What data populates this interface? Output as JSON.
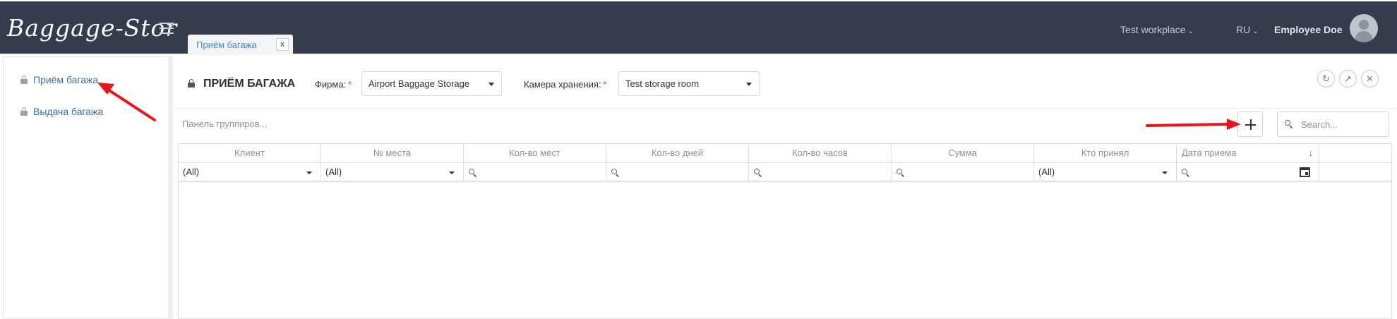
{
  "app": {
    "logo_text": "Baggage-Stor"
  },
  "header": {
    "open_tab_label": "Приём багажа",
    "open_tab_close": "x",
    "workplace_label": "Test workplace",
    "language_label": "RU",
    "user_name": "Employee Doe"
  },
  "sidebar": {
    "items": [
      {
        "label": "Приём багажа"
      },
      {
        "label": "Выдача багажа"
      }
    ]
  },
  "page": {
    "title": "ПРИЁМ БАГАЖА",
    "firm_label": "Фирма:",
    "firm_value": "Airport Baggage Storage",
    "storage_label": "Камера хранения:",
    "storage_value": "Test storage room",
    "required_mark": "*"
  },
  "toolbar": {
    "group_panel_text": "Панель группиров...",
    "search_placeholder": "Search..."
  },
  "grid": {
    "columns": [
      {
        "header": "Клиент",
        "filter": "(All)"
      },
      {
        "header": "№ места",
        "filter": "(All)"
      },
      {
        "header": "Кол-во мест",
        "filter": ""
      },
      {
        "header": "Кол-во дней",
        "filter": ""
      },
      {
        "header": "Кол-во часов",
        "filter": ""
      },
      {
        "header": "Сумма",
        "filter": ""
      },
      {
        "header": "Кто принял",
        "filter": "(All)"
      },
      {
        "header": "Дата приема",
        "filter": ""
      }
    ],
    "sort_indicator": "↓",
    "rows": []
  },
  "colors": {
    "header_bg": "#353c4e",
    "link": "#3c6f9c",
    "tab_text": "#3c8dbc",
    "annotation_arrow": "#e8141b",
    "required": "#e53935"
  }
}
